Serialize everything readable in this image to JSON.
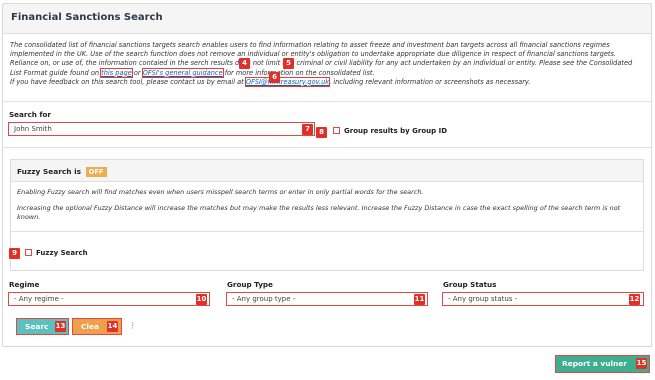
{
  "panel": {
    "title": "Financial Sanctions Search"
  },
  "intro": {
    "text1": "The consolidated list of financial sanctions targets search enables users to find information relating to asset freeze and investment ban targets across all financial sanctions regimes implemented in the UK. Use of the search function does not remove an individual or entity's obligation to undertake appropriate due diligence in respect of financial sanctions targets. Reliance on, or use of, the information contai",
    "text2": "ed in the se",
    "text3": "rch results does not limit any criminal or civil liability for any act undertaken by an individual or entity. Please see the Consolidated List Format guide found on ",
    "link_this_page": "this page",
    "text4": " or ",
    "link_guidance": "OFSI's general guidance",
    "text5": " for more information on the consolidated list.",
    "text6": "If you have feedback on this search tool, please contact us by email at ",
    "link_email": "OFSI@hmtreasury.gov.uk",
    "text7": ", including relevant information or screenshots as necessary."
  },
  "search": {
    "label": "Search for",
    "value": "John Smith",
    "group_label": "Group results by Group ID"
  },
  "fuzzy": {
    "title": "Fuzzy Search is",
    "status": "OFF",
    "desc1": "Enabling Fuzzy search will find matches even when users misspell search terms or enter in only partial words for the search.",
    "desc2": "Increasing the optional Fuzzy Distance will increase the matches but may make the results less relevant. Increase the Fuzzy Distance in case the exact spelling of the search term is not known.",
    "checkbox_label": "Fuzzy Search"
  },
  "filters": {
    "regime_label": "Regime",
    "regime_value": "- Any regime -",
    "type_label": "Group Type",
    "type_value": "- Any group type -",
    "status_label": "Group Status",
    "status_value": "- Any group status -"
  },
  "buttons": {
    "search": "Searc",
    "clear": "Clea",
    "report": "Report a vulner"
  },
  "badges": {
    "b4": "4",
    "b5": "5",
    "b6": "6",
    "b7": "7",
    "b8": "8",
    "b9": "9",
    "b10": "10",
    "b11": "11",
    "b12": "12",
    "b13": "13",
    "b14": "14",
    "b15": "15"
  },
  "colors": {
    "search_button": "#5bc0be",
    "clear_button": "#f0a04b",
    "report_button": "#3fae8e",
    "badge": "#e0302a",
    "off_badge": "#f0ad4e"
  }
}
